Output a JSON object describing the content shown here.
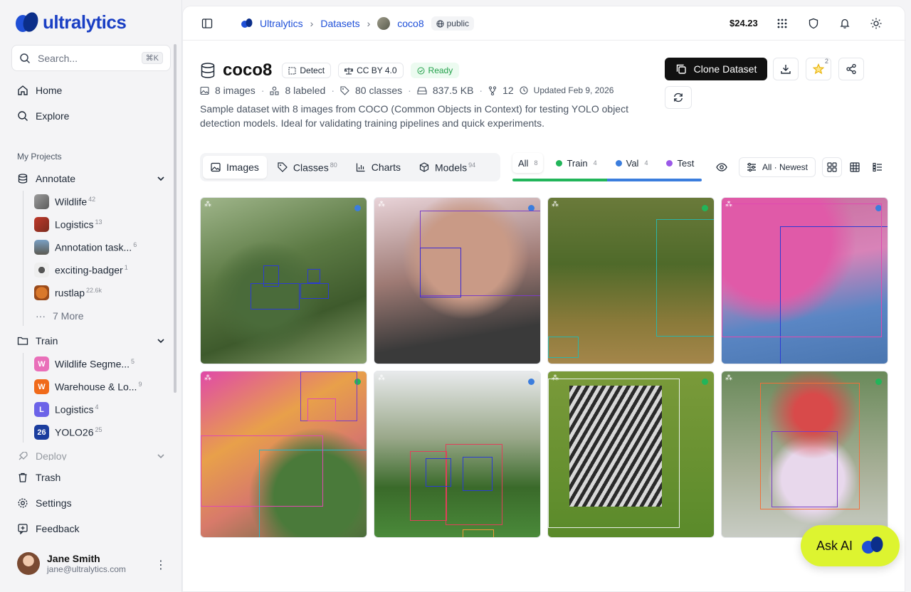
{
  "app": {
    "name": "ultralytics"
  },
  "search": {
    "placeholder": "Search...",
    "shortcut": "⌘K"
  },
  "nav": {
    "home": "Home",
    "explore": "Explore",
    "trash": "Trash",
    "settings": "Settings",
    "feedback": "Feedback"
  },
  "projects_label": "My Projects",
  "annotate": {
    "label": "Annotate",
    "items": [
      {
        "label": "Wildlife",
        "count": "42"
      },
      {
        "label": "Logistics",
        "count": "13"
      },
      {
        "label": "Annotation task...",
        "count": "6"
      },
      {
        "label": "exciting-badger",
        "count": "1"
      },
      {
        "label": "rustlap",
        "count": "22.6k"
      }
    ],
    "more": "7 More"
  },
  "train": {
    "label": "Train",
    "items": [
      {
        "letter": "W",
        "label": "Wildlife Segme...",
        "count": "5",
        "color": "#e96fb9"
      },
      {
        "letter": "W",
        "label": "Warehouse & Lo...",
        "count": "9",
        "color": "#f06a1a"
      },
      {
        "letter": "L",
        "label": "Logistics",
        "count": "4",
        "color": "#6c63e8"
      },
      {
        "letter": "26",
        "label": "YOLO26",
        "count": "25",
        "color": "#1b3d9e"
      }
    ]
  },
  "deploy": {
    "label": "Deploy"
  },
  "user": {
    "name": "Jane Smith",
    "email": "jane@ultralytics.com"
  },
  "breadcrumb": {
    "root": "Ultralytics",
    "section": "Datasets",
    "current": "coco8",
    "visibility": "public"
  },
  "balance": "$24.23",
  "dataset": {
    "name": "coco8",
    "task": "Detect",
    "license": "CC BY 4.0",
    "status": "Ready",
    "images": "8 images",
    "labeled": "8 labeled",
    "classes": "80 classes",
    "size": "837.5 KB",
    "versions": "12",
    "updated": "Updated Feb 9, 2026",
    "description": "Sample dataset with 8 images from COCO (Common Objects in Context) for testing YOLO object detection models. Ideal for validating training pipelines and quick experiments."
  },
  "actions": {
    "clone": "Clone Dataset",
    "star_count": "2"
  },
  "tabs": [
    {
      "label": "Images",
      "count": ""
    },
    {
      "label": "Classes",
      "count": "80"
    },
    {
      "label": "Charts",
      "count": ""
    },
    {
      "label": "Models",
      "count": "94"
    }
  ],
  "splits": {
    "all": {
      "label": "All",
      "count": "8"
    },
    "train": {
      "label": "Train",
      "count": "4",
      "color": "#22b55a"
    },
    "val": {
      "label": "Val",
      "count": "4",
      "color": "#3b7ddd"
    },
    "test": {
      "label": "Test",
      "color": "#9b59e8"
    },
    "bar_fractions": {
      "train": 0.5,
      "val": 0.5
    }
  },
  "sort": {
    "label": "All · Newest"
  },
  "ask_ai": "Ask AI",
  "colors": {
    "brand": "#1a3fc4",
    "accent": "#ddf430",
    "ready": "#22a04a"
  }
}
